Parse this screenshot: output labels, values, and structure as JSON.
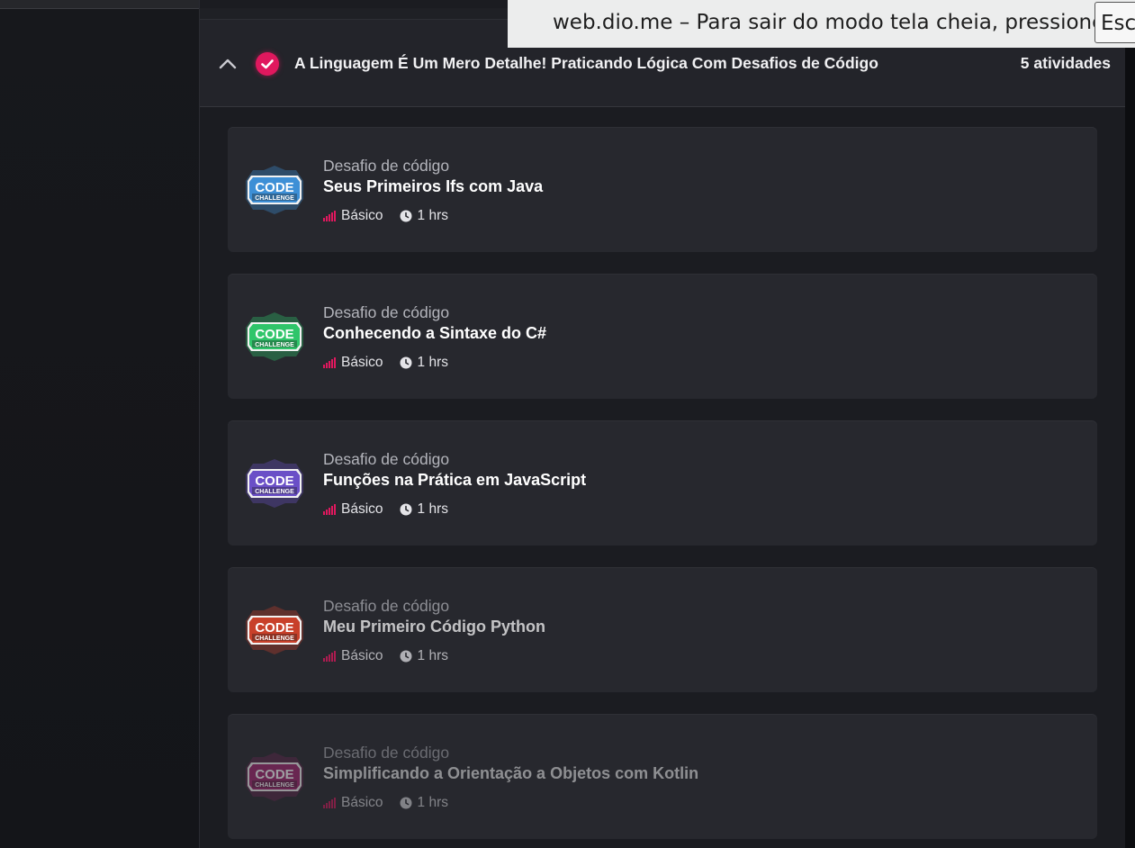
{
  "fullscreen_notice": {
    "message": "web.dio.me – Para sair do modo tela cheia, pressione",
    "key": "Esc"
  },
  "section": {
    "title": "A Linguagem É Um Mero Detalhe! Praticando Lógica Com Desafios de Código",
    "count": "5 atividades",
    "expanded": true
  },
  "colors": {
    "accent": "#e0185e",
    "card_bg": "#27282e",
    "page_bg": "#1b1c21"
  },
  "activities": [
    {
      "type": "Desafio de código",
      "title": "Seus Primeiros Ifs com Java",
      "level": "Básico",
      "duration": "1 hrs",
      "logo": "CODE CHALLENGE",
      "logo_color": "#3d8fd6"
    },
    {
      "type": "Desafio de código",
      "title": "Conhecendo a Sintaxe do C#",
      "level": "Básico",
      "duration": "1 hrs",
      "logo": "CODE CHALLENGE",
      "logo_color": "#2fc56a"
    },
    {
      "type": "Desafio de código",
      "title": "Funções na Prática em JavaScript",
      "level": "Básico",
      "duration": "1 hrs",
      "logo": "CODE CHALLENGE",
      "logo_color": "#6a4fc7"
    },
    {
      "type": "Desafio de código",
      "title": "Meu Primeiro Código Python",
      "level": "Básico",
      "duration": "1 hrs",
      "logo": "CODE CHALLENGE",
      "logo_color": "#c8402a"
    },
    {
      "type": "Desafio de código",
      "title": "Simplificando a Orientação a Objetos com Kotlin",
      "level": "Básico",
      "duration": "1 hrs",
      "logo": "CODE CHALLENGE",
      "logo_color": "#a0266f"
    }
  ]
}
